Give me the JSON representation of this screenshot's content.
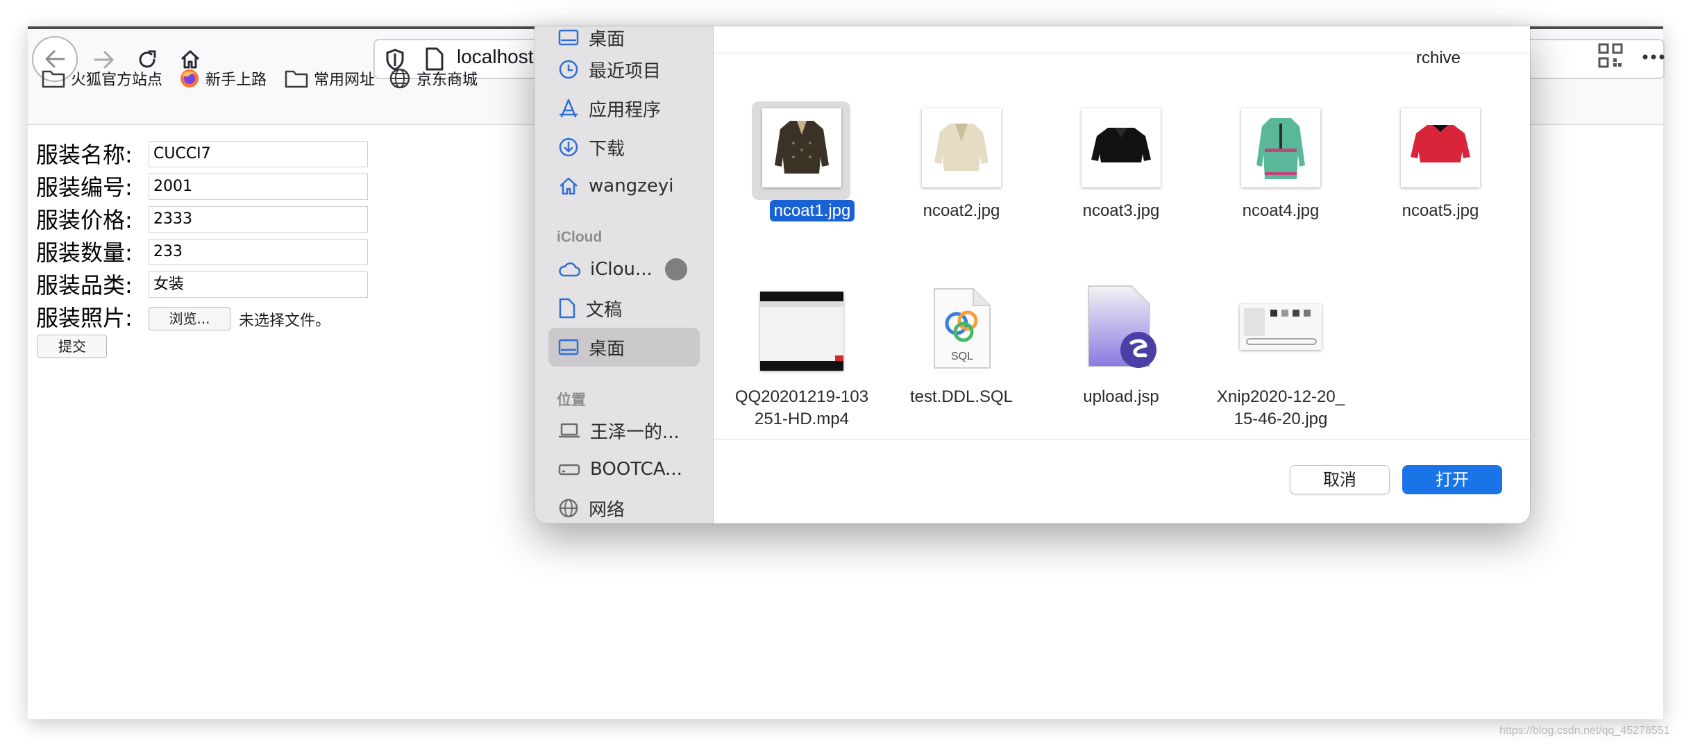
{
  "browser": {
    "url_text": "localhost",
    "bookmarks": [
      {
        "label": "火狐官方站点",
        "icon": "folder-icon"
      },
      {
        "label": "新手上路",
        "icon": "firefox-icon"
      },
      {
        "label": "常用网址",
        "icon": "folder-icon"
      },
      {
        "label": "京东商城",
        "icon": "globe-icon"
      }
    ]
  },
  "form": {
    "fields": [
      {
        "label": "服装名称:",
        "value": "CUCCI7"
      },
      {
        "label": "服装编号:",
        "value": "2001"
      },
      {
        "label": "服装价格:",
        "value": "2333"
      },
      {
        "label": "服装数量:",
        "value": "233"
      },
      {
        "label": "服装品类:",
        "value": "女装"
      }
    ],
    "photo_label": "服装照片:",
    "browse_label": "浏览...",
    "no_file_text": "未选择文件。",
    "submit_label": "提交"
  },
  "dialog": {
    "sidebar": {
      "items": [
        {
          "label": "桌面",
          "icon": "desktop-icon"
        },
        {
          "label": "最近项目",
          "icon": "clock-icon"
        },
        {
          "label": "应用程序",
          "icon": "apps-icon"
        },
        {
          "label": "下载",
          "icon": "download-icon"
        },
        {
          "label": "wangzeyi",
          "icon": "home-icon"
        }
      ],
      "icloud_heading": "iCloud",
      "icloud_items": [
        {
          "label": "iClou...",
          "icon": "cloud-icon"
        },
        {
          "label": "文稿",
          "icon": "document-icon"
        },
        {
          "label": "桌面",
          "icon": "desktop-icon",
          "selected": true
        }
      ],
      "locations_heading": "位置",
      "location_items": [
        {
          "label": "王泽一的...",
          "icon": "laptop-icon"
        },
        {
          "label": "BOOTCA...",
          "icon": "drive-icon"
        },
        {
          "label": "网络",
          "icon": "network-icon"
        }
      ]
    },
    "archive_label": "rchive",
    "files": [
      {
        "name": "ncoat1.jpg",
        "selected": true,
        "colors": [
          "#3b3226",
          "#c7b48f"
        ]
      },
      {
        "name": "ncoat2.jpg",
        "colors": [
          "#e6dcc4",
          "#cbbd9c"
        ]
      },
      {
        "name": "ncoat3.jpg",
        "colors": [
          "#111111",
          "#2a2a2a"
        ]
      },
      {
        "name": "ncoat4.jpg",
        "colors": [
          "#5bb79a",
          "#c0457a"
        ]
      },
      {
        "name": "ncoat5.jpg",
        "colors": [
          "#d8253a",
          "#a81a2b"
        ]
      },
      {
        "name": "QQ20201219-103\n251-HD.mp4"
      },
      {
        "name": "test.DDL.SQL",
        "badge": "SQL"
      },
      {
        "name": "upload.jsp"
      },
      {
        "name": "Xnip2020-12-20_\n15-46-20.jpg"
      }
    ],
    "cancel_label": "取消",
    "open_label": "打开"
  },
  "watermark": "https://blog.csdn.net/qq_45278551"
}
